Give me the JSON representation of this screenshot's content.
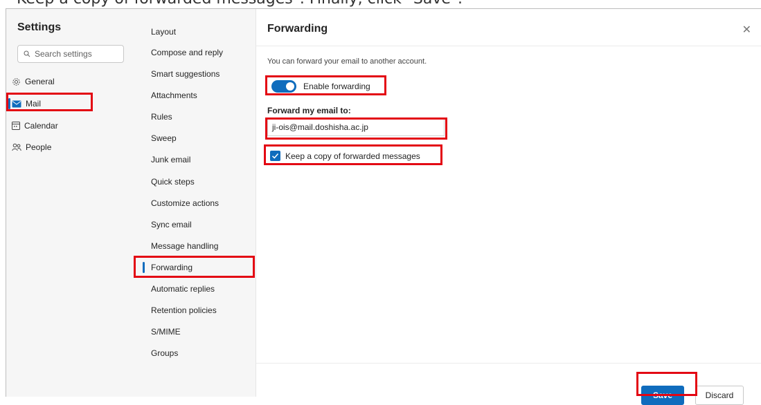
{
  "caption": "Keep a copy of forwarded messages\". Finally, click \"Save\".",
  "settings": {
    "title": "Settings",
    "search_placeholder": "Search settings",
    "categories": [
      {
        "label": "General",
        "icon": "gear-icon"
      },
      {
        "label": "Mail",
        "icon": "mail-icon",
        "selected": true
      },
      {
        "label": "Calendar",
        "icon": "calendar-icon"
      },
      {
        "label": "People",
        "icon": "people-icon"
      }
    ]
  },
  "mail_settings": {
    "items": [
      "Layout",
      "Compose and reply",
      "Smart suggestions",
      "Attachments",
      "Rules",
      "Sweep",
      "Junk email",
      "Quick steps",
      "Customize actions",
      "Sync email",
      "Message handling",
      "Forwarding",
      "Automatic replies",
      "Retention policies",
      "S/MIME",
      "Groups"
    ],
    "selected": "Forwarding"
  },
  "forwarding": {
    "title": "Forwarding",
    "close_icon": "close-icon",
    "description": "You can forward your email to another account.",
    "enable_label": "Enable forwarding",
    "enabled": true,
    "forward_to_label": "Forward my email to:",
    "email_value": "ji-ois@mail.doshisha.ac.jp",
    "keep_copy_label": "Keep a copy of forwarded messages",
    "keep_copy_checked": true
  },
  "footer": {
    "save_label": "Save",
    "discard_label": "Discard"
  },
  "colors": {
    "accent": "#0f6cbd",
    "highlight": "#e30613"
  }
}
